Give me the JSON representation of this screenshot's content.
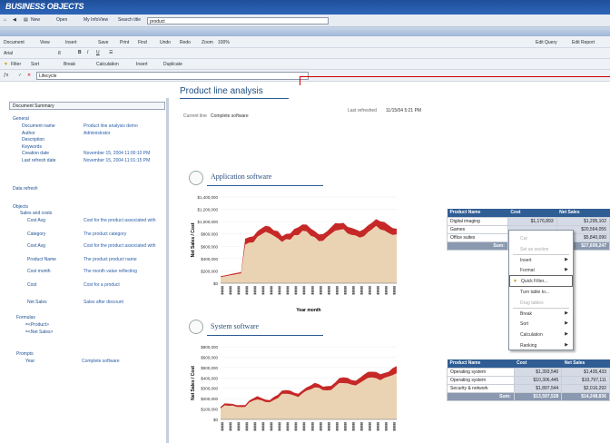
{
  "app": {
    "brand": "BUSINESS OBJECTS"
  },
  "nav": {
    "items": [
      "New",
      "Open",
      "My InfoView",
      "Search title"
    ],
    "search_value": "product"
  },
  "toolbar1": {
    "items": [
      "Document",
      "View",
      "Insert",
      "Save",
      "Print",
      "Find",
      "Undo",
      "Redo",
      "Zoom",
      "100%"
    ],
    "right": [
      "Edit Query",
      "Edit Report"
    ]
  },
  "toolbar2": {
    "font": "Arial",
    "size": "8"
  },
  "toolbar3": {
    "items": [
      "Filter",
      "Sort",
      "Break",
      "Calculation",
      "Insert",
      "Duplicate"
    ]
  },
  "toolbar4": {
    "formula": "Lifecycle"
  },
  "left": {
    "header": "Document Summary",
    "general": "General",
    "fields": [
      {
        "k": "Document name",
        "v": "Product line analysis demo"
      },
      {
        "k": "Author",
        "v": "Administrator"
      },
      {
        "k": "Description",
        "v": ""
      },
      {
        "k": "Keywords",
        "v": ""
      },
      {
        "k": "Creation date",
        "v": "November 15, 2004 11:00:10 PM"
      },
      {
        "k": "Last refresh date",
        "v": "November 15, 2004 11:01:15 PM"
      }
    ],
    "data_refresh": "Data refresh",
    "objects": "Objects",
    "sales": "Sales and costs",
    "obj_rows": [
      {
        "k": "Cost Avg",
        "v": "Cost for the product associated with"
      },
      {
        "k": "Category",
        "v": "The product category"
      },
      {
        "k": "Cost Avg",
        "v": "Cost for the product associated with"
      },
      {
        "k": "Product Name",
        "v": "The product product name"
      },
      {
        "k": "Cost month",
        "v": "The month value reflecting"
      },
      {
        "k": "Cost",
        "v": "Cost for a product"
      },
      {
        "k": "Net Sales",
        "v": "Sales after discount"
      }
    ],
    "formulas": "Formulas",
    "formula_items": [
      "=<Product>",
      "=<Net Sales>"
    ],
    "prompts": "Prompts",
    "prompt_k": "Year",
    "prompt_v": "Complete software"
  },
  "report": {
    "title": "Product line analysis",
    "filter_label": "Current line",
    "filter_value": "Complete software",
    "refreshed_label": "Last refreshed",
    "refreshed_value": "11/15/04 5:21 PM",
    "section1": "Application software",
    "section2": "System software",
    "y_label": "Net Sales / Cost",
    "x_label": "Year month",
    "chart1_ticks": [
      "$1,400,000",
      "$1,200,000",
      "$1,000,000",
      "$800,000",
      "$600,000",
      "$400,000",
      "$200,000",
      "$0"
    ],
    "chart2_ticks": [
      "$800,000",
      "$600,000",
      "$500,000",
      "$400,000",
      "$300,000",
      "$200,000",
      "$100,000",
      "$0"
    ]
  },
  "table1": {
    "headers": [
      "Product Name",
      "Cost",
      "Net Sales"
    ],
    "rows": [
      [
        "Digital imaging",
        "$1,176,893",
        "$1,295,102"
      ],
      [
        "Games",
        "",
        "$20,564,055"
      ],
      [
        "Office suites",
        "",
        "$5,840,090"
      ]
    ],
    "total_label": "Sum:",
    "total_values": [
      "",
      "$27,699,247"
    ]
  },
  "table2": {
    "headers": [
      "Product Name",
      "Cost",
      "Net Sales"
    ],
    "rows": [
      [
        "Operating system",
        "$1,393,540",
        "$1,435,433"
      ],
      [
        "Operating system",
        "$10,306,445",
        "$10,797,111"
      ],
      [
        "Security & network",
        "$1,897,544",
        "$2,016,292"
      ]
    ],
    "total_label": "Sum:",
    "total_values": [
      "$13,597,528",
      "$14,248,836"
    ]
  },
  "context_menu": {
    "items": [
      {
        "label": "Cut",
        "disabled": true
      },
      {
        "label": "Set as section",
        "disabled": true
      },
      {
        "label": "Insert",
        "sub": true
      },
      {
        "label": "Format",
        "sub": true
      },
      {
        "label": "Quick Filter...",
        "selected": true
      },
      {
        "label": "Turn table to...",
        "disabled": false
      },
      {
        "label": "Drag tables",
        "disabled": true
      },
      {
        "label": "Break",
        "sub": true
      },
      {
        "label": "Sort",
        "sub": true
      },
      {
        "label": "Calculation",
        "sub": true
      },
      {
        "label": "Ranking",
        "sub": true
      }
    ]
  },
  "colors": {
    "brand_blue": "#2e66b8",
    "table_header": "#2f5d94",
    "chart_cost": "#c62828",
    "chart_fill": "#e8d2b0"
  }
}
